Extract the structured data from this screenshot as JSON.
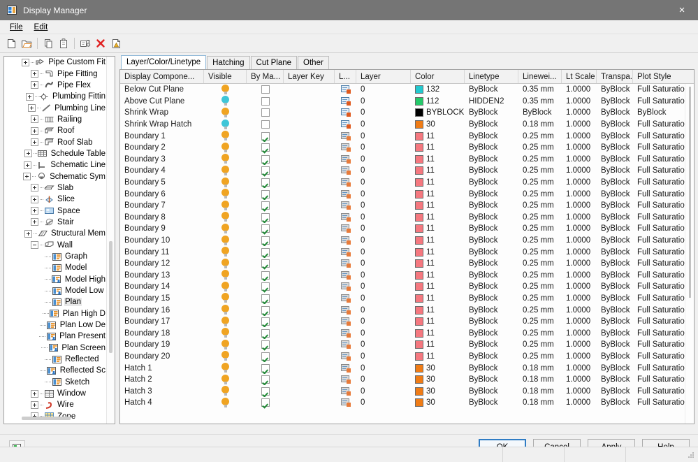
{
  "window": {
    "title": "Display Manager",
    "icon": "app-window-icon",
    "close_label": "×"
  },
  "menubar": {
    "items": [
      {
        "label": "File",
        "accel": "F"
      },
      {
        "label": "Edit",
        "accel": "E"
      }
    ]
  },
  "toolbar": {
    "buttons": [
      {
        "name": "new-icon",
        "title": "New"
      },
      {
        "name": "open-folder-icon",
        "title": "Open"
      },
      {
        "name": "copy-icon",
        "title": "Copy"
      },
      {
        "name": "paste-icon",
        "title": "Paste"
      },
      {
        "name": "rename-icon",
        "title": "Rename"
      },
      {
        "name": "delete-x-icon",
        "title": "Delete"
      },
      {
        "name": "purge-icon",
        "title": "Purge"
      }
    ]
  },
  "tree": {
    "items": [
      {
        "label": "Pipe Custom Fit",
        "depth": 1,
        "expander": "plus",
        "icon": "pipe-custom-fitting-icon"
      },
      {
        "label": "Pipe Fitting",
        "depth": 1,
        "expander": "plus",
        "icon": "pipe-fitting-icon"
      },
      {
        "label": "Pipe Flex",
        "depth": 1,
        "expander": "plus",
        "icon": "pipe-flex-icon"
      },
      {
        "label": "Plumbing Fittin",
        "depth": 1,
        "expander": "plus",
        "icon": "plumbing-fitting-icon"
      },
      {
        "label": "Plumbing Line",
        "depth": 1,
        "expander": "plus",
        "icon": "plumbing-line-icon"
      },
      {
        "label": "Railing",
        "depth": 1,
        "expander": "plus",
        "icon": "railing-icon"
      },
      {
        "label": "Roof",
        "depth": 1,
        "expander": "plus",
        "icon": "roof-icon"
      },
      {
        "label": "Roof Slab",
        "depth": 1,
        "expander": "plus",
        "icon": "roof-slab-icon"
      },
      {
        "label": "Schedule Table",
        "depth": 1,
        "expander": "plus",
        "icon": "schedule-table-icon"
      },
      {
        "label": "Schematic Line",
        "depth": 1,
        "expander": "plus",
        "icon": "schematic-line-icon"
      },
      {
        "label": "Schematic Sym",
        "depth": 1,
        "expander": "plus",
        "icon": "schematic-symbol-icon"
      },
      {
        "label": "Slab",
        "depth": 1,
        "expander": "plus",
        "icon": "slab-icon"
      },
      {
        "label": "Slice",
        "depth": 1,
        "expander": "plus",
        "icon": "slice-icon"
      },
      {
        "label": "Space",
        "depth": 1,
        "expander": "plus",
        "icon": "space-icon"
      },
      {
        "label": "Stair",
        "depth": 1,
        "expander": "plus",
        "icon": "stair-icon"
      },
      {
        "label": "Structural Mem",
        "depth": 1,
        "expander": "plus",
        "icon": "structural-member-icon"
      },
      {
        "label": "Wall",
        "depth": 1,
        "expander": "minus",
        "icon": "wall-icon"
      },
      {
        "label": "Graph",
        "depth": 2,
        "expander": "none",
        "icon": "display-rep-icon"
      },
      {
        "label": "Model",
        "depth": 2,
        "expander": "none",
        "icon": "display-rep-icon"
      },
      {
        "label": "Model High",
        "depth": 2,
        "expander": "none",
        "icon": "display-rep-user-icon"
      },
      {
        "label": "Model Low",
        "depth": 2,
        "expander": "none",
        "icon": "display-rep-user-icon"
      },
      {
        "label": "Plan",
        "depth": 2,
        "expander": "none",
        "icon": "display-rep-icon",
        "selected": true
      },
      {
        "label": "Plan High D",
        "depth": 2,
        "expander": "none",
        "icon": "display-rep-icon"
      },
      {
        "label": "Plan Low De",
        "depth": 2,
        "expander": "none",
        "icon": "display-rep-icon"
      },
      {
        "label": "Plan Present",
        "depth": 2,
        "expander": "none",
        "icon": "display-rep-user-icon"
      },
      {
        "label": "Plan Screen",
        "depth": 2,
        "expander": "none",
        "icon": "display-rep-user-icon"
      },
      {
        "label": "Reflected",
        "depth": 2,
        "expander": "none",
        "icon": "display-rep-icon"
      },
      {
        "label": "Reflected Sc",
        "depth": 2,
        "expander": "none",
        "icon": "display-rep-user-icon"
      },
      {
        "label": "Sketch",
        "depth": 2,
        "expander": "none",
        "icon": "display-rep-icon"
      },
      {
        "label": "Window",
        "depth": 1,
        "expander": "plus",
        "icon": "window-icon"
      },
      {
        "label": "Wire",
        "depth": 1,
        "expander": "plus",
        "icon": "wire-icon"
      },
      {
        "label": "Zone",
        "depth": 1,
        "expander": "plus",
        "icon": "zone-icon"
      }
    ]
  },
  "tabs": [
    {
      "label": "Layer/Color/Linetype",
      "active": true
    },
    {
      "label": "Hatching",
      "active": false
    },
    {
      "label": "Cut Plane",
      "active": false
    },
    {
      "label": "Other",
      "active": false
    }
  ],
  "grid": {
    "columns": [
      {
        "key": "name",
        "label": "Display Compone...",
        "cls": "c-name"
      },
      {
        "key": "visible",
        "label": "Visible",
        "cls": "c-vis"
      },
      {
        "key": "by_mat",
        "label": "By Ma...",
        "cls": "c-byma"
      },
      {
        "key": "layer_key",
        "label": "Layer Key",
        "cls": "c-key"
      },
      {
        "key": "l_over",
        "label": "L...",
        "cls": "c-lo"
      },
      {
        "key": "layer",
        "label": "Layer",
        "cls": "c-layer"
      },
      {
        "key": "color",
        "label": "Color",
        "cls": "c-color"
      },
      {
        "key": "linetype",
        "label": "Linetype",
        "cls": "c-lt"
      },
      {
        "key": "lineweight",
        "label": "Linewei...",
        "cls": "c-lw"
      },
      {
        "key": "lt_scale",
        "label": "Lt Scale",
        "cls": "c-lts"
      },
      {
        "key": "transp",
        "label": "Transpa...",
        "cls": "c-tr"
      },
      {
        "key": "plot",
        "label": "Plot Style",
        "cls": "c-ps"
      }
    ],
    "rows": [
      {
        "name": "Below Cut Plane",
        "bulb": "#f0a422",
        "checked": false,
        "layer_key": "",
        "layer": "0",
        "color_name": "132",
        "color_hex": "#22c9cf",
        "linetype": "ByBlock",
        "lineweight": "0.35 mm",
        "lt_scale": "1.0000",
        "transp": "ByBlock",
        "plot": "Full Saturation",
        "lyactive": true
      },
      {
        "name": "Above Cut Plane",
        "bulb": "#3fc6d8",
        "checked": false,
        "layer_key": "",
        "layer": "0",
        "color_name": "112",
        "color_hex": "#25c96a",
        "linetype": "HIDDEN2",
        "lineweight": "0.35 mm",
        "lt_scale": "1.0000",
        "transp": "ByBlock",
        "plot": "Full Saturation",
        "lyactive": true
      },
      {
        "name": "Shrink Wrap",
        "bulb": "#f0a422",
        "checked": false,
        "layer_key": "",
        "layer": "0",
        "color_name": "BYBLOCK",
        "color_hex": "#000000",
        "linetype": "ByBlock",
        "lineweight": "ByBlock",
        "lt_scale": "1.0000",
        "transp": "ByBlock",
        "plot": "ByBlock",
        "lyactive": true
      },
      {
        "name": "Shrink Wrap Hatch",
        "bulb": "#3fc6d8",
        "checked": false,
        "layer_key": "",
        "layer": "0",
        "color_name": "30",
        "color_hex": "#f07c16",
        "linetype": "ByBlock",
        "lineweight": "0.18 mm",
        "lt_scale": "1.0000",
        "transp": "ByBlock",
        "plot": "Full Saturation",
        "lyactive": true
      },
      {
        "name": "Boundary 1",
        "bulb": "#f0a422",
        "checked": true,
        "layer_key": "",
        "layer": "0",
        "color_name": "11",
        "color_hex": "#f5787f",
        "linetype": "ByBlock",
        "lineweight": "0.25 mm",
        "lt_scale": "1.0000",
        "transp": "ByBlock",
        "plot": "Full Saturation",
        "lyactive": false
      },
      {
        "name": "Boundary 2",
        "bulb": "#f0a422",
        "checked": true,
        "layer_key": "",
        "layer": "0",
        "color_name": "11",
        "color_hex": "#f5787f",
        "linetype": "ByBlock",
        "lineweight": "0.25 mm",
        "lt_scale": "1.0000",
        "transp": "ByBlock",
        "plot": "Full Saturation",
        "lyactive": false
      },
      {
        "name": "Boundary 3",
        "bulb": "#f0a422",
        "checked": true,
        "layer_key": "",
        "layer": "0",
        "color_name": "11",
        "color_hex": "#f5787f",
        "linetype": "ByBlock",
        "lineweight": "0.25 mm",
        "lt_scale": "1.0000",
        "transp": "ByBlock",
        "plot": "Full Saturation",
        "lyactive": false
      },
      {
        "name": "Boundary 4",
        "bulb": "#f0a422",
        "checked": true,
        "layer_key": "",
        "layer": "0",
        "color_name": "11",
        "color_hex": "#f5787f",
        "linetype": "ByBlock",
        "lineweight": "0.25 mm",
        "lt_scale": "1.0000",
        "transp": "ByBlock",
        "plot": "Full Saturation",
        "lyactive": false
      },
      {
        "name": "Boundary 5",
        "bulb": "#f0a422",
        "checked": true,
        "layer_key": "",
        "layer": "0",
        "color_name": "11",
        "color_hex": "#f5787f",
        "linetype": "ByBlock",
        "lineweight": "0.25 mm",
        "lt_scale": "1.0000",
        "transp": "ByBlock",
        "plot": "Full Saturation",
        "lyactive": false
      },
      {
        "name": "Boundary 6",
        "bulb": "#f0a422",
        "checked": true,
        "layer_key": "",
        "layer": "0",
        "color_name": "11",
        "color_hex": "#f5787f",
        "linetype": "ByBlock",
        "lineweight": "0.25 mm",
        "lt_scale": "1.0000",
        "transp": "ByBlock",
        "plot": "Full Saturation",
        "lyactive": false
      },
      {
        "name": "Boundary 7",
        "bulb": "#f0a422",
        "checked": true,
        "layer_key": "",
        "layer": "0",
        "color_name": "11",
        "color_hex": "#f5787f",
        "linetype": "ByBlock",
        "lineweight": "0.25 mm",
        "lt_scale": "1.0000",
        "transp": "ByBlock",
        "plot": "Full Saturation",
        "lyactive": false
      },
      {
        "name": "Boundary 8",
        "bulb": "#f0a422",
        "checked": true,
        "layer_key": "",
        "layer": "0",
        "color_name": "11",
        "color_hex": "#f5787f",
        "linetype": "ByBlock",
        "lineweight": "0.25 mm",
        "lt_scale": "1.0000",
        "transp": "ByBlock",
        "plot": "Full Saturation",
        "lyactive": false
      },
      {
        "name": "Boundary 9",
        "bulb": "#f0a422",
        "checked": true,
        "layer_key": "",
        "layer": "0",
        "color_name": "11",
        "color_hex": "#f5787f",
        "linetype": "ByBlock",
        "lineweight": "0.25 mm",
        "lt_scale": "1.0000",
        "transp": "ByBlock",
        "plot": "Full Saturation",
        "lyactive": false
      },
      {
        "name": "Boundary 10",
        "bulb": "#f0a422",
        "checked": true,
        "layer_key": "",
        "layer": "0",
        "color_name": "11",
        "color_hex": "#f5787f",
        "linetype": "ByBlock",
        "lineweight": "0.25 mm",
        "lt_scale": "1.0000",
        "transp": "ByBlock",
        "plot": "Full Saturation",
        "lyactive": false
      },
      {
        "name": "Boundary 11",
        "bulb": "#f0a422",
        "checked": true,
        "layer_key": "",
        "layer": "0",
        "color_name": "11",
        "color_hex": "#f5787f",
        "linetype": "ByBlock",
        "lineweight": "0.25 mm",
        "lt_scale": "1.0000",
        "transp": "ByBlock",
        "plot": "Full Saturation",
        "lyactive": false
      },
      {
        "name": "Boundary 12",
        "bulb": "#f0a422",
        "checked": true,
        "layer_key": "",
        "layer": "0",
        "color_name": "11",
        "color_hex": "#f5787f",
        "linetype": "ByBlock",
        "lineweight": "0.25 mm",
        "lt_scale": "1.0000",
        "transp": "ByBlock",
        "plot": "Full Saturation",
        "lyactive": false
      },
      {
        "name": "Boundary 13",
        "bulb": "#f0a422",
        "checked": true,
        "layer_key": "",
        "layer": "0",
        "color_name": "11",
        "color_hex": "#f5787f",
        "linetype": "ByBlock",
        "lineweight": "0.25 mm",
        "lt_scale": "1.0000",
        "transp": "ByBlock",
        "plot": "Full Saturation",
        "lyactive": false
      },
      {
        "name": "Boundary 14",
        "bulb": "#f0a422",
        "checked": true,
        "layer_key": "",
        "layer": "0",
        "color_name": "11",
        "color_hex": "#f5787f",
        "linetype": "ByBlock",
        "lineweight": "0.25 mm",
        "lt_scale": "1.0000",
        "transp": "ByBlock",
        "plot": "Full Saturation",
        "lyactive": false
      },
      {
        "name": "Boundary 15",
        "bulb": "#f0a422",
        "checked": true,
        "layer_key": "",
        "layer": "0",
        "color_name": "11",
        "color_hex": "#f5787f",
        "linetype": "ByBlock",
        "lineweight": "0.25 mm",
        "lt_scale": "1.0000",
        "transp": "ByBlock",
        "plot": "Full Saturation",
        "lyactive": false
      },
      {
        "name": "Boundary 16",
        "bulb": "#f0a422",
        "checked": true,
        "layer_key": "",
        "layer": "0",
        "color_name": "11",
        "color_hex": "#f5787f",
        "linetype": "ByBlock",
        "lineweight": "0.25 mm",
        "lt_scale": "1.0000",
        "transp": "ByBlock",
        "plot": "Full Saturation",
        "lyactive": false
      },
      {
        "name": "Boundary 17",
        "bulb": "#f0a422",
        "checked": true,
        "layer_key": "",
        "layer": "0",
        "color_name": "11",
        "color_hex": "#f5787f",
        "linetype": "ByBlock",
        "lineweight": "0.25 mm",
        "lt_scale": "1.0000",
        "transp": "ByBlock",
        "plot": "Full Saturation",
        "lyactive": false
      },
      {
        "name": "Boundary 18",
        "bulb": "#f0a422",
        "checked": true,
        "layer_key": "",
        "layer": "0",
        "color_name": "11",
        "color_hex": "#f5787f",
        "linetype": "ByBlock",
        "lineweight": "0.25 mm",
        "lt_scale": "1.0000",
        "transp": "ByBlock",
        "plot": "Full Saturation",
        "lyactive": false
      },
      {
        "name": "Boundary 19",
        "bulb": "#f0a422",
        "checked": true,
        "layer_key": "",
        "layer": "0",
        "color_name": "11",
        "color_hex": "#f5787f",
        "linetype": "ByBlock",
        "lineweight": "0.25 mm",
        "lt_scale": "1.0000",
        "transp": "ByBlock",
        "plot": "Full Saturation",
        "lyactive": false
      },
      {
        "name": "Boundary 20",
        "bulb": "#f0a422",
        "checked": true,
        "layer_key": "",
        "layer": "0",
        "color_name": "11",
        "color_hex": "#f5787f",
        "linetype": "ByBlock",
        "lineweight": "0.25 mm",
        "lt_scale": "1.0000",
        "transp": "ByBlock",
        "plot": "Full Saturation",
        "lyactive": false
      },
      {
        "name": "Hatch 1",
        "bulb": "#f0a422",
        "checked": true,
        "layer_key": "",
        "layer": "0",
        "color_name": "30",
        "color_hex": "#f07c16",
        "linetype": "ByBlock",
        "lineweight": "0.18 mm",
        "lt_scale": "1.0000",
        "transp": "ByBlock",
        "plot": "Full Saturation",
        "lyactive": false
      },
      {
        "name": "Hatch 2",
        "bulb": "#f0a422",
        "checked": true,
        "layer_key": "",
        "layer": "0",
        "color_name": "30",
        "color_hex": "#f07c16",
        "linetype": "ByBlock",
        "lineweight": "0.18 mm",
        "lt_scale": "1.0000",
        "transp": "ByBlock",
        "plot": "Full Saturation",
        "lyactive": false
      },
      {
        "name": "Hatch 3",
        "bulb": "#f0a422",
        "checked": true,
        "layer_key": "",
        "layer": "0",
        "color_name": "30",
        "color_hex": "#f07c16",
        "linetype": "ByBlock",
        "lineweight": "0.18 mm",
        "lt_scale": "1.0000",
        "transp": "ByBlock",
        "plot": "Full Saturation",
        "lyactive": false
      },
      {
        "name": "Hatch 4",
        "bulb": "#f0a422",
        "checked": true,
        "layer_key": "",
        "layer": "0",
        "color_name": "30",
        "color_hex": "#f07c16",
        "linetype": "ByBlock",
        "lineweight": "0.18 mm",
        "lt_scale": "1.0000",
        "transp": "ByBlock",
        "plot": "Full Saturation",
        "lyactive": false
      }
    ]
  },
  "footer": {
    "config_icon": "display-config-icon",
    "buttons": [
      {
        "label": "OK",
        "accel": "",
        "default": true
      },
      {
        "label": "Cancel",
        "accel": "",
        "default": false
      },
      {
        "label": "Apply",
        "accel": "A",
        "default": false
      },
      {
        "label": "Help",
        "accel": "",
        "default": false
      }
    ]
  },
  "colors": {
    "titlebar_bg": "#757575",
    "chrome_bg": "#f0f0f0",
    "accent_blue": "#2f7cc4",
    "bulb_on": "#f0a422",
    "bulb_cyan": "#3fc6d8",
    "check_green": "#1f8a35"
  }
}
